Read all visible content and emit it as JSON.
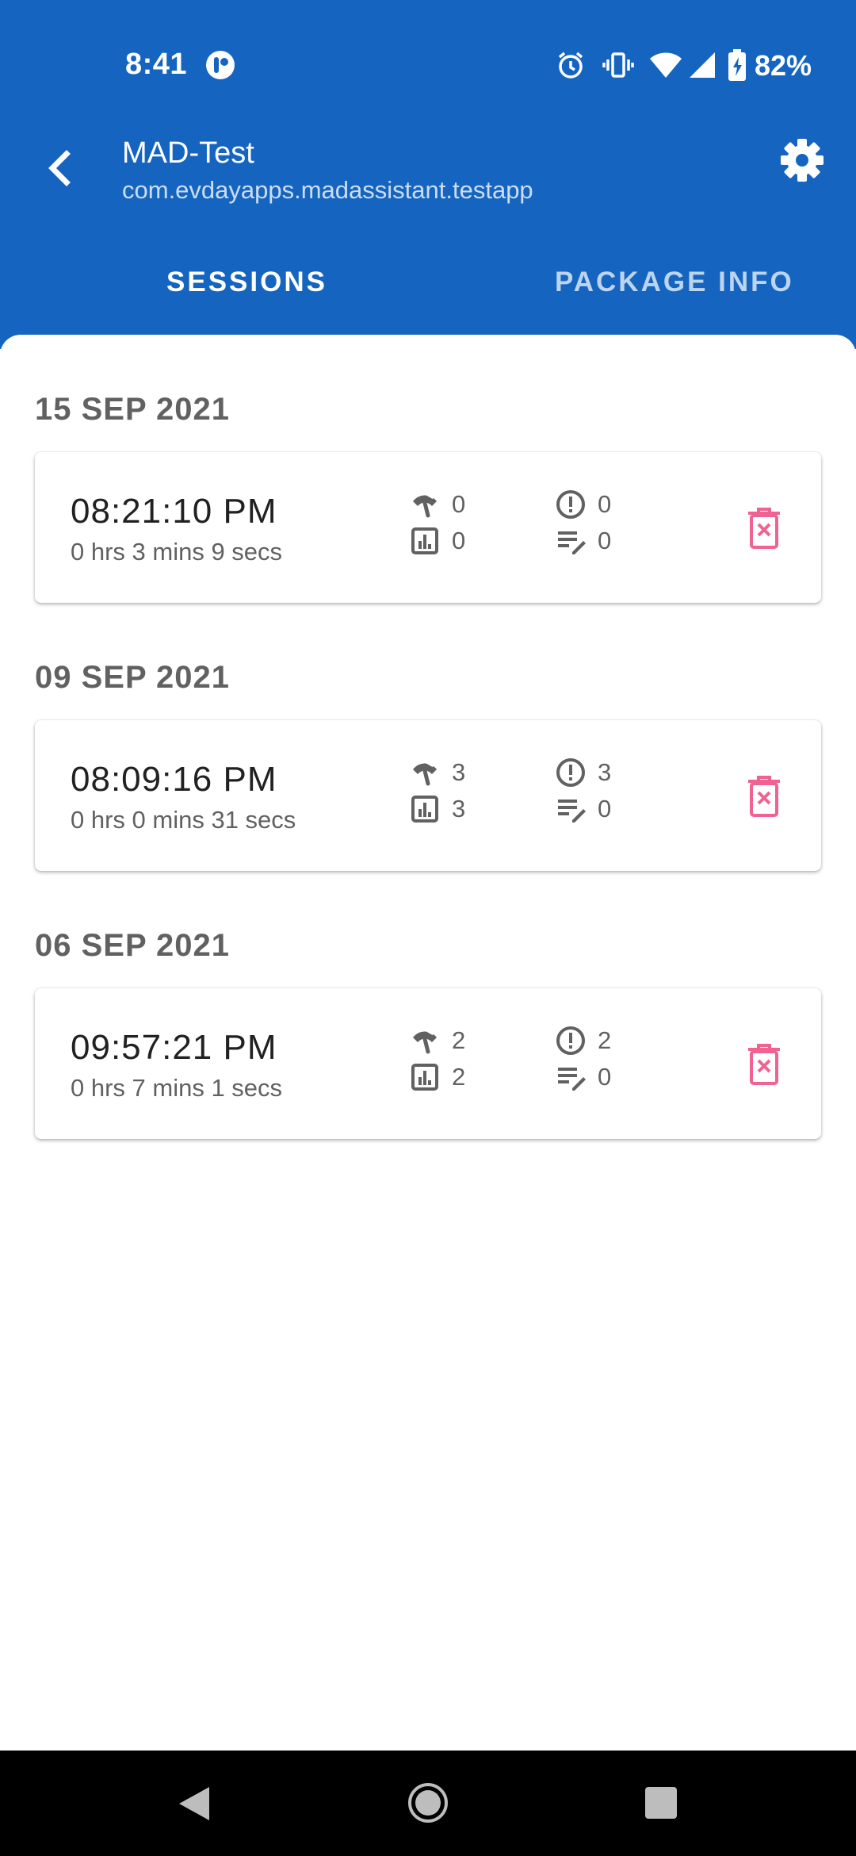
{
  "status_bar": {
    "time": "8:41",
    "battery_percent": "82%",
    "icons": [
      "notification-icon",
      "alarm-icon",
      "vibrate-icon",
      "wifi-icon",
      "signal-icon",
      "battery-icon"
    ]
  },
  "header": {
    "title": "MAD-Test",
    "subtitle": "com.evdayapps.madassistant.testapp",
    "background_color": "#1565c0"
  },
  "tabs": [
    {
      "label": "SESSIONS",
      "active": true
    },
    {
      "label": "PACKAGE INFO",
      "active": false
    }
  ],
  "groups": [
    {
      "date": "15 SEP 2021",
      "session": {
        "time": "08:21:10 PM",
        "duration": "0 hrs 3 mins 9 secs",
        "network": "0",
        "analytics": "0",
        "exceptions": "0",
        "logs": "0"
      }
    },
    {
      "date": "09 SEP 2021",
      "session": {
        "time": "08:09:16 PM",
        "duration": "0 hrs 0 mins 31 secs",
        "network": "3",
        "analytics": "3",
        "exceptions": "3",
        "logs": "0"
      }
    },
    {
      "date": "06 SEP 2021",
      "session": {
        "time": "09:57:21 PM",
        "duration": "0 hrs 7 mins 1 secs",
        "network": "2",
        "analytics": "2",
        "exceptions": "2",
        "logs": "0"
      }
    }
  ],
  "colors": {
    "delete": "#f06292",
    "stat_icon": "#616161"
  }
}
